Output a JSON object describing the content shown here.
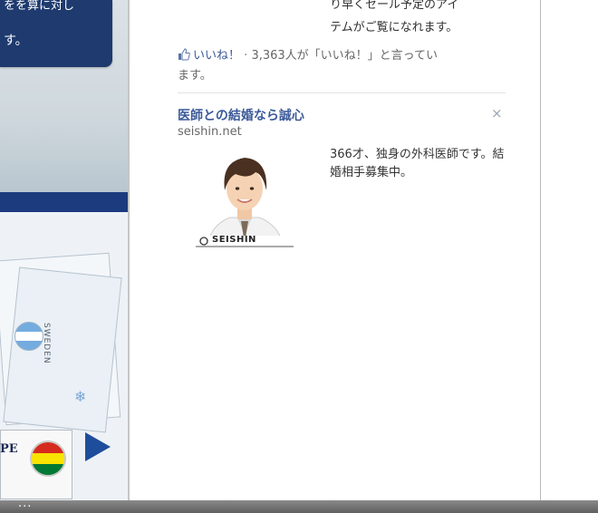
{
  "left_page": {
    "banner_text_line1": "をを算に対し",
    "banner_text_line2": "す。",
    "stamp_text": "SWEDEN",
    "card_label": "PE",
    "flag_left": "argentina-flag",
    "flag_right": "bolivia-flag",
    "arrow_color": "#1e4e9b",
    "banner_color": "#1e3a6e"
  },
  "sidebar": {
    "prev_ad_text_line1": "り早くセール予定のアイ",
    "prev_ad_text_line2": "テムがご覧になれます。",
    "like_link": "いいね！",
    "like_separator": "·",
    "like_count_text": "3,363人が「いいね！」と言ってい",
    "like_count_text_wrap": "ます。",
    "ad": {
      "title": "医師との結婚なら誠心",
      "domain": "seishin.net",
      "image_caption": "SEISHIN",
      "description": "366才、独身の外科医師です。結婚相手募集中。",
      "close_glyph": "×"
    }
  },
  "status_bar": {
    "dots": "..."
  },
  "colors": {
    "link": "#3b5998",
    "text": "#333333",
    "muted": "#666666",
    "status_bar": "#6e6e6e"
  }
}
